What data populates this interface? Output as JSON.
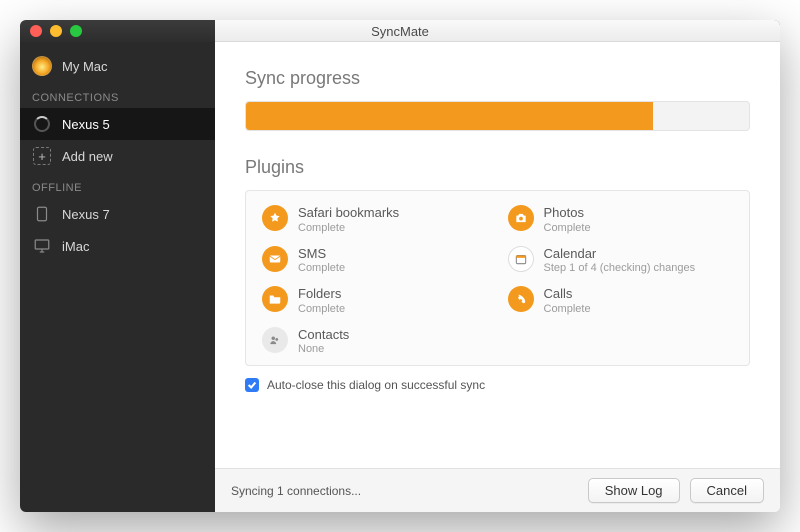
{
  "title": "SyncMate",
  "sidebar": {
    "mymac": "My Mac",
    "headers": {
      "connections": "CONNECTIONS",
      "offline": "OFFLINE"
    },
    "connections": [
      {
        "label": "Nexus 5"
      }
    ],
    "addnew": "Add new",
    "offline": [
      {
        "label": "Nexus 7"
      },
      {
        "label": "iMac"
      }
    ]
  },
  "main": {
    "progress_heading": "Sync progress",
    "progress_percent": 81,
    "plugins_heading": "Plugins",
    "plugins": [
      {
        "name": "Safari bookmarks",
        "status": "Complete",
        "icon": "star",
        "color": "orange"
      },
      {
        "name": "Photos",
        "status": "Complete",
        "icon": "camera",
        "color": "orange"
      },
      {
        "name": "SMS",
        "status": "Complete",
        "icon": "mail",
        "color": "orange"
      },
      {
        "name": "Calendar",
        "status": "Step 1 of 4 (checking) changes",
        "icon": "calendar",
        "color": "white"
      },
      {
        "name": "Folders",
        "status": "Complete",
        "icon": "folder",
        "color": "orange"
      },
      {
        "name": "Calls",
        "status": "Complete",
        "icon": "phone",
        "color": "orange"
      },
      {
        "name": "Contacts",
        "status": "None",
        "icon": "contacts",
        "color": "grey"
      }
    ],
    "autoclose_label": "Auto-close this dialog on successful sync",
    "autoclose_checked": true
  },
  "footer": {
    "status": "Syncing 1 connections...",
    "showlog": "Show Log",
    "cancel": "Cancel"
  }
}
